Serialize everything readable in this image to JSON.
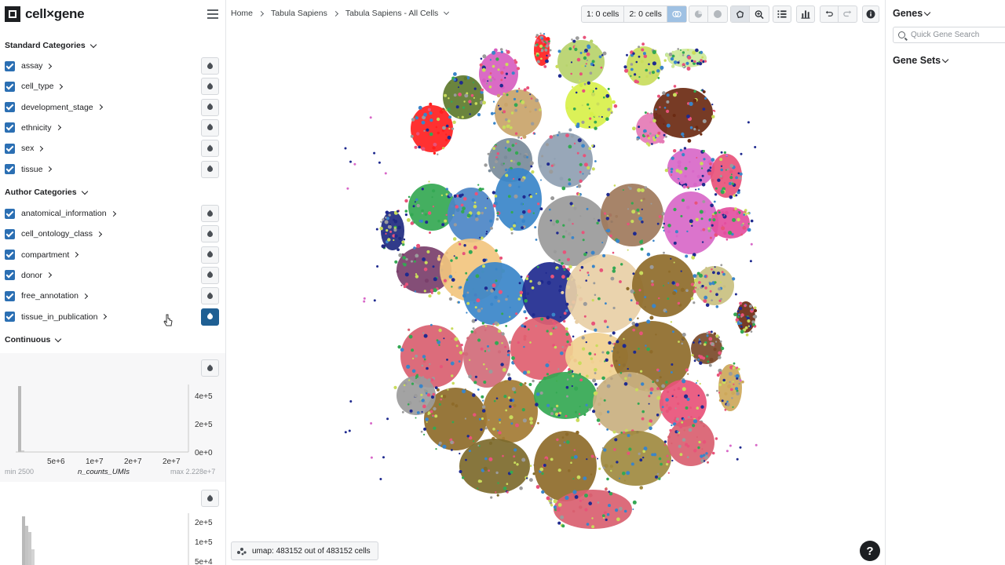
{
  "app": {
    "name": "cell×gene"
  },
  "breadcrumb": [
    "Home",
    "Tabula Sapiens",
    "Tabula Sapiens - All Cells"
  ],
  "toolbar": {
    "cells1": "1: 0 cells",
    "cells2": "2: 0 cells"
  },
  "left": {
    "standard_title": "Standard Categories",
    "standard": [
      "assay",
      "cell_type",
      "development_stage",
      "ethnicity",
      "sex",
      "tissue"
    ],
    "author_title": "Author Categories",
    "author": [
      "anatomical_information",
      "cell_ontology_class",
      "compartment",
      "donor",
      "free_annotation",
      "tissue_in_publication"
    ],
    "continuous_title": "Continuous",
    "hist1": {
      "y_ticks": [
        "4e+5",
        "2e+5",
        "0e+0"
      ],
      "x_ticks": [
        "5e+6",
        "1e+7",
        "2e+7",
        "2e+7"
      ],
      "min": "min 2500",
      "label": "n_counts_UMIs",
      "max": "max 2.228e+7"
    },
    "hist2": {
      "y_ticks": [
        "2e+5",
        "1e+5",
        "5e+4"
      ]
    }
  },
  "right": {
    "genes_title": "Genes",
    "search_placeholder": "Quick Gene Search",
    "genesets_title": "Gene Sets"
  },
  "status": {
    "text": "umap: 483152 out of 483152 cells"
  },
  "help": {
    "label": "?"
  },
  "colors": {
    "accent": "#2b6fb3",
    "active": "#1f5f93"
  }
}
